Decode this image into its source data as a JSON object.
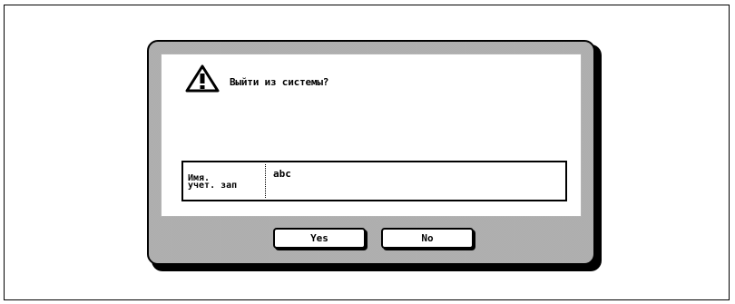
{
  "dialog": {
    "icon": "warning-icon",
    "message": "Выйти из системы?",
    "account": {
      "label_line1": "Имя.",
      "label_line2": "учет. зап",
      "value": "abc"
    },
    "buttons": {
      "yes_label": "Yes",
      "no_label": "No"
    }
  }
}
